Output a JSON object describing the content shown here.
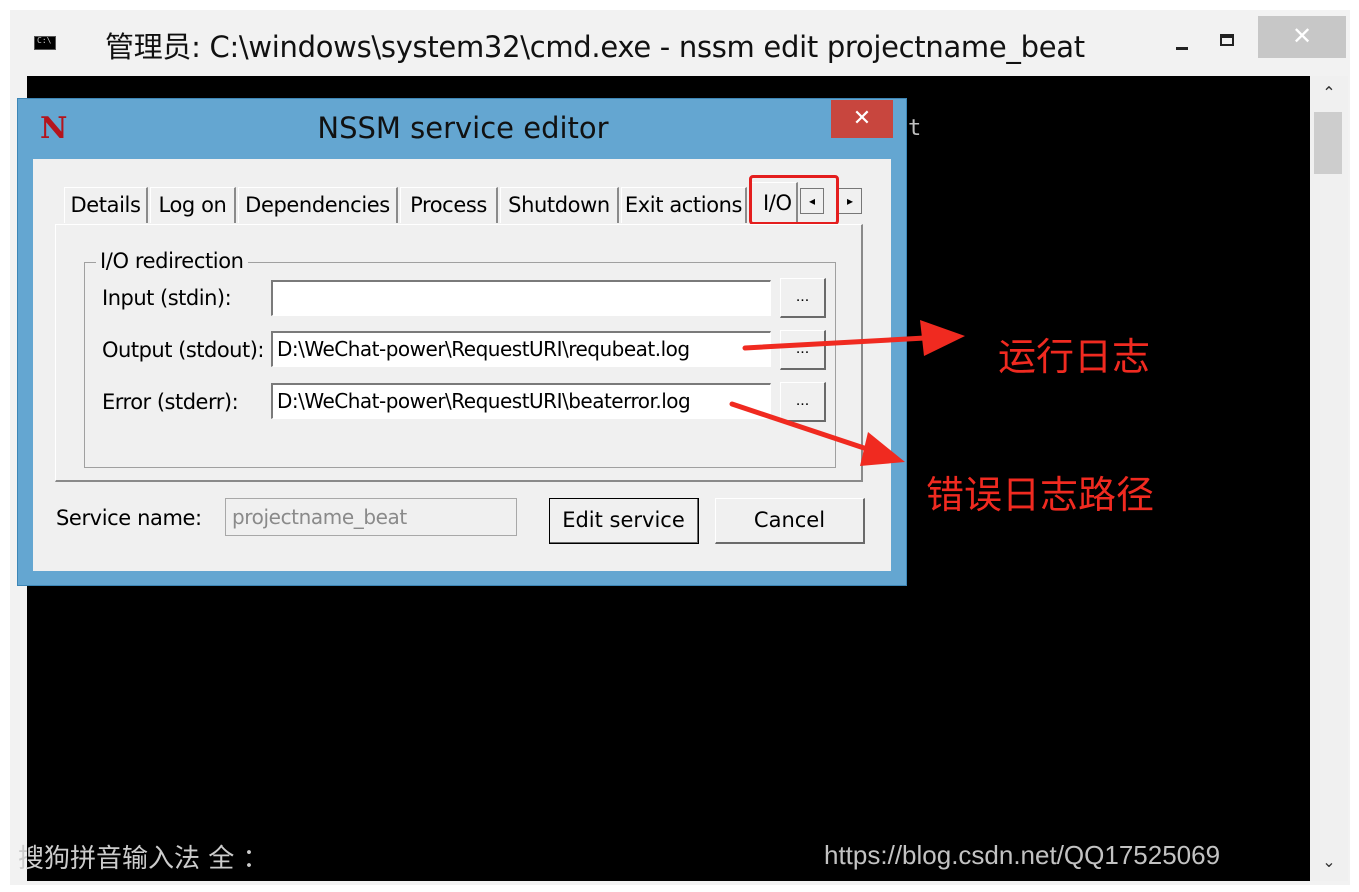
{
  "cmd": {
    "title": "管理员: C:\\windows\\system32\\cmd.exe - nssm  edit projectname_beat",
    "close_glyph": "✕",
    "console_fragment": "t",
    "ime_status": "搜狗拼音输入法 全 ："
  },
  "watermark": "https://blog.csdn.net/QQ17525069",
  "nssm": {
    "logo": "N",
    "title": "NSSM service editor",
    "close_glyph": "✕",
    "tabs": [
      {
        "label": "Details"
      },
      {
        "label": "Log on"
      },
      {
        "label": "Dependencies"
      },
      {
        "label": "Process"
      },
      {
        "label": "Shutdown"
      },
      {
        "label": "Exit actions"
      },
      {
        "label": "I/O"
      }
    ],
    "tab_scroll_left": "◂",
    "tab_scroll_right": "▸",
    "io": {
      "group_title": "I/O redirection",
      "input_label": "Input (stdin):",
      "input_value": "",
      "output_label": "Output (stdout):",
      "output_value": "D:\\WeChat-power\\RequestURI\\requbeat.log",
      "error_label": "Error (stderr):",
      "error_value": "D:\\WeChat-power\\RequestURI\\beaterror.log",
      "browse_label": "..."
    },
    "service_name_label": "Service name:",
    "service_name_value": "projectname_beat",
    "edit_button": "Edit service",
    "cancel_button": "Cancel"
  },
  "annotations": {
    "output_note": "运行日志",
    "error_note": "错误日志路径",
    "arrow_color": "#f02a20"
  }
}
